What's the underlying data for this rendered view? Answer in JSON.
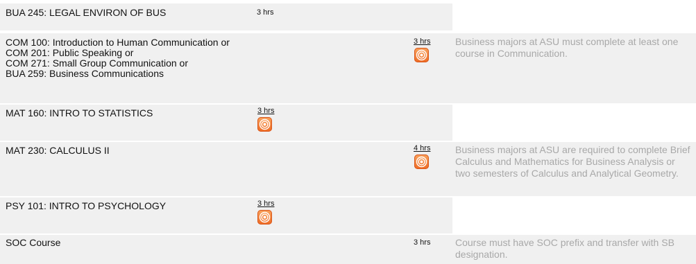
{
  "rows": [
    {
      "courses": [
        "BUA 245: LEGAL ENVIRON OF BUS"
      ],
      "hours": "3 hrs",
      "note": ""
    },
    {
      "courses": [
        "COM 100: Introduction to Human Communication or",
        "COM 201: Public Speaking or",
        "COM 271: Small Group Communication or",
        "BUA 259: Business Communications"
      ],
      "hours": "3 hrs",
      "note": "Business majors at ASU must complete at least one course in Communication."
    },
    {
      "courses": [
        "MAT 160: INTRO TO STATISTICS"
      ],
      "hours": "3 hrs",
      "note": ""
    },
    {
      "courses": [
        "MAT 230: CALCULUS II"
      ],
      "hours": "4 hrs",
      "note": "Business majors at ASU are required to complete Brief Calculus and Mathematics for Business Analysis or two semesters of Calculus and Analytical Geometry."
    },
    {
      "courses": [
        "PSY 101: INTRO TO PSYCHOLOGY"
      ],
      "hours": "3 hrs",
      "note": ""
    },
    {
      "courses": [
        "SOC Course"
      ],
      "hours": "3 hrs",
      "note": "Course must have SOC prefix and transfer with SB designation."
    }
  ],
  "icon": "online-course-icon"
}
